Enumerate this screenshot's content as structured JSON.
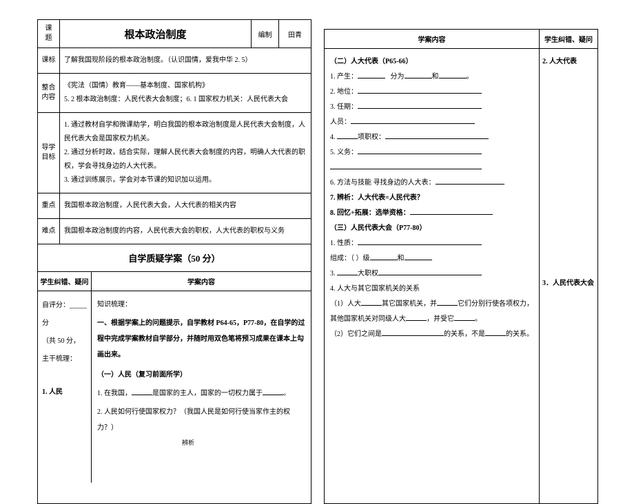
{
  "left": {
    "topicLabel": "课\n题",
    "title": "根本政治制度",
    "compilerLabel": "编制",
    "compilerValue": "田青",
    "rows": {
      "kebiao": {
        "label": "课标",
        "content": "了解我国现阶段的根本政治制度。（认识国情，爱我中华 2. 5）"
      },
      "zhenghe": {
        "label": "整合\n内容",
        "line1": "《宪法（国情）教育——基本制度、国家机构》",
        "line2": "5. 2 根本政治制度：人民代表大会制度；6. 1 国家权力机关：人民代表大会"
      },
      "daoxue": {
        "label": "导学\n目标",
        "line1": "1. 通过教材自学和微课助学，明白我国的根本政治制度是人民代表大会制度，人民代表大会是国家权力机关。",
        "line2": "2. 通过分析时政，结合实际，理解人民代表大会制度的内容，明确人大代表的职权，学会寻找身边的人大代表。",
        "line3": "3. 通过训练展示，学会对本节课的知识加以运用。"
      },
      "zhongdian": {
        "label": "重点",
        "content": "我国根本政治制度，人民代表大会，人大代表的相关内容"
      },
      "nandian": {
        "label": "难点",
        "content": "我国根本政治制度的内容，人民代表大会的职权，人大代表的职权与义务"
      }
    },
    "sectionTitle": "自学质疑学案（50 分）",
    "subHeader": {
      "left": "学生纠错、疑问",
      "right": "学案内容"
    },
    "bodyLeft": {
      "l1": "自评分：_____分",
      "l2": "（共 50 分，",
      "l3": "主干梳理：",
      "l4": "1. 人民"
    },
    "bodyRight": {
      "l1": "知识梳理：",
      "l2": "一、根据学案上的问题提示，自学教材 P64-65，P77-80，在自学的过程中完成学案教材自学部分，并随时用双色笔将预习成果在课本上勾画出来。",
      "l3": "（一）人民（复习前面所学）",
      "l4_pre": "1. 在我国，",
      "l4_post": "是国家的主人，国家的一切权力属于",
      "l5": "2. 人民如何行使国家权力？（我国人民是如何行使当家作主的权力？）"
    }
  },
  "right": {
    "header": {
      "main": "学案内容",
      "side": "学生纠错、疑问"
    },
    "side": {
      "n2": "2. 人大代表",
      "n3": "3．人民代表大会"
    },
    "main": {
      "s2_title": "（二）人大代表（P65-66）",
      "s2_1_a": "1. 产生：",
      "s2_1_b": "分为",
      "s2_1_c": "和",
      "s2_2": "2. 地位：",
      "s2_3": "3. 任期：",
      "s2_3b": "人员：",
      "s2_4a": "4. ",
      "s2_4b": "项职权：",
      "s2_5": "5. 义务：",
      "s2_6": "6. 方法与技能  寻找身边的人大表：",
      "s2_7": "7. 辨析：人大代表=人民代表？",
      "s2_8": "8. 回忆+拓展：选举资格：",
      "s3_title": "（三）人民代表大会（P77-80）",
      "s3_1a": "1. 性质：",
      "s3_1b": "组成：（    ）级",
      "s3_1c": "和",
      "s3_3a": "3. ",
      "s3_3b": "大职权",
      "s3_4": "4. 人大与其它国家机关的关系",
      "s3_41a": "（1）人大",
      "s3_41b": "其它国家机关，并",
      "s3_41c": "它们分别行使各项权力，其他国家机关对同级人大",
      "s3_41d": "，并受它",
      "s3_42a": "（2）它们之间是",
      "s3_42b": "的关系，不是",
      "s3_42c": "的关系。"
    }
  },
  "footerFragment": "辨析"
}
